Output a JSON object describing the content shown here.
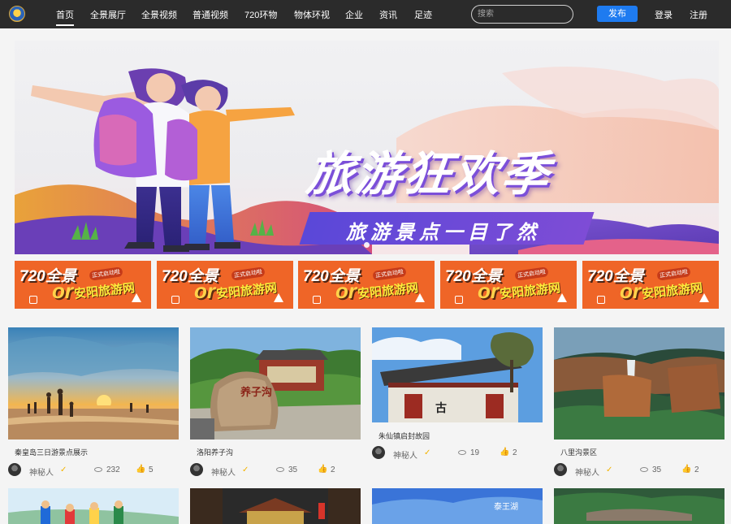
{
  "nav": {
    "items": [
      "首页",
      "全景展厅",
      "全景视频",
      "普通视频",
      "720环物",
      "物体环视",
      "企业",
      "资讯",
      "足迹"
    ],
    "search_placeholder": "搜索",
    "publish": "发布",
    "login": "登录",
    "register": "注册"
  },
  "banner": {
    "title": "旅游狂欢季",
    "subtitle": "旅游景点一目了然"
  },
  "promo": {
    "badge": "720全景",
    "or": "or",
    "tag": "正式启动啦",
    "name": "安阳旅游网"
  },
  "cards": [
    {
      "title": "秦皇岛三日游景点展示",
      "author": "神秘人",
      "views": "232",
      "likes": "5"
    },
    {
      "title": "洛阳养子沟",
      "author": "神秘人",
      "views": "35",
      "likes": "2"
    },
    {
      "title": "朱仙镇启封故园",
      "author": "神秘人",
      "views": "19",
      "likes": "2"
    },
    {
      "title": "八里沟景区",
      "author": "神秘人",
      "views": "35",
      "likes": "2"
    }
  ],
  "thumb_text": {
    "stone": "养子沟",
    "sign": "古",
    "lake": "泰王湖"
  }
}
